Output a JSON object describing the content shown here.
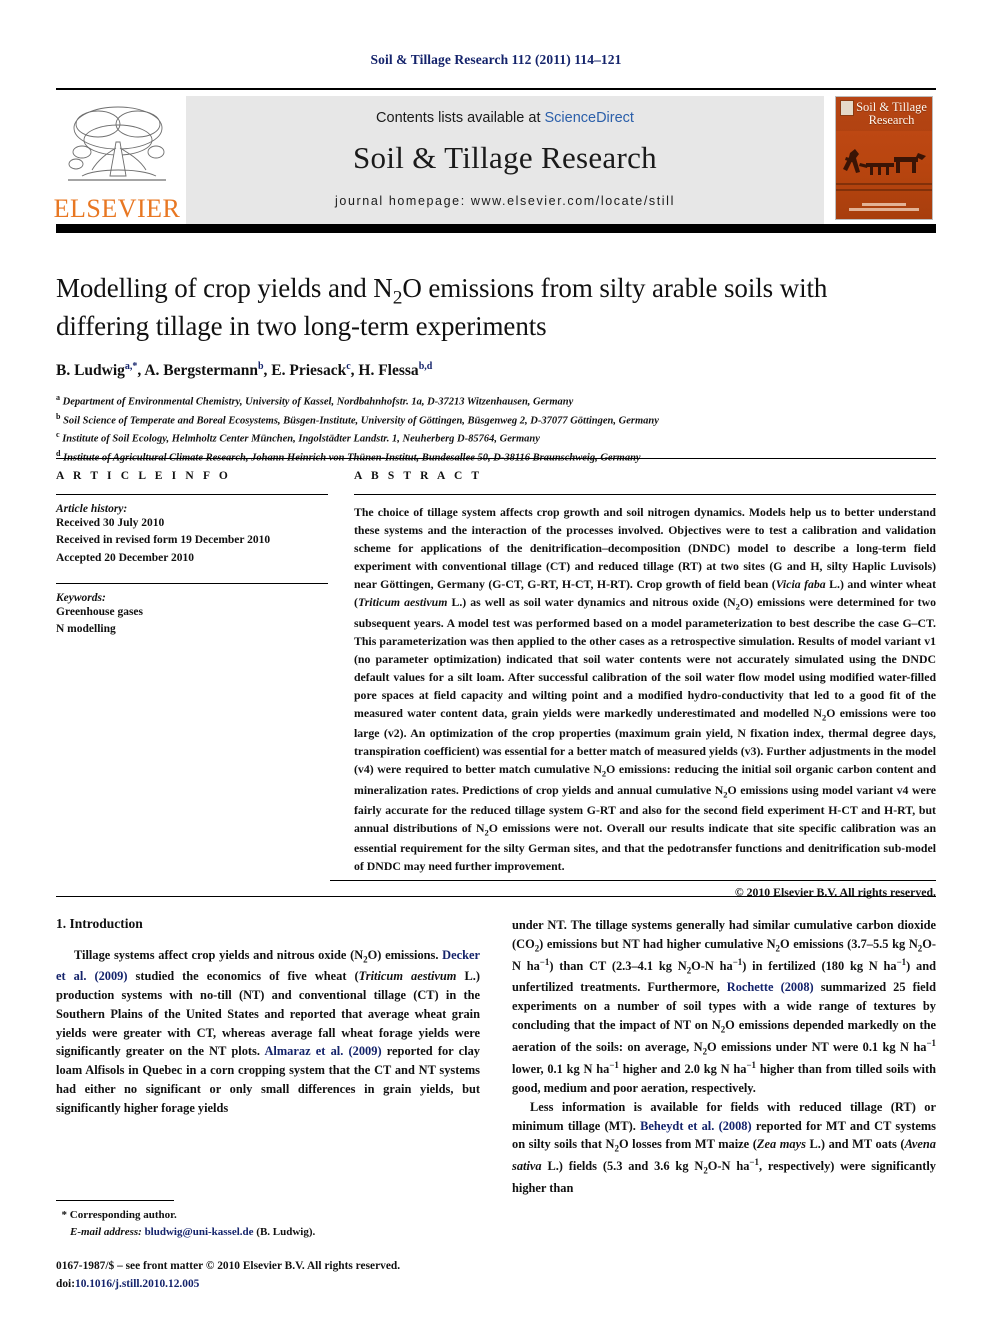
{
  "running_head": "Soil & Tillage Research 112 (2011) 114–121",
  "masthead": {
    "contents_prefix": "Contents lists available at ",
    "sciencedirect": "ScienceDirect",
    "journal_title": "Soil & Tillage Research",
    "homepage": "journal homepage: www.elsevier.com/locate/still",
    "publisher": "ELSEVIER",
    "cover_title": "Soil & Tillage Research",
    "colors": {
      "running_head": "#14236b",
      "link": "#2b5faa",
      "elsevier_orange": "#e87722",
      "cover_orange": "#b8450f",
      "masthead_gray": "#e7e7e7"
    }
  },
  "article": {
    "title_line1": "Modelling of crop yields and N2O emissions from silty arable soils with",
    "title_line2": "differing tillage in two long-term experiments",
    "authors_plain": "B. Ludwig a,*, A. Bergstermann b, E. Priesack c, H. Flessa b,d",
    "authors": [
      {
        "name": "B. Ludwig",
        "marks": "a,*"
      },
      {
        "name": "A. Bergstermann",
        "marks": "b"
      },
      {
        "name": "E. Priesack",
        "marks": "c"
      },
      {
        "name": "H. Flessa",
        "marks": "b,d"
      }
    ],
    "affiliations": [
      {
        "mark": "a",
        "text": "Department of Environmental Chemistry, University of Kassel, Nordbahnhofstr. 1a, D-37213 Witzenhausen, Germany"
      },
      {
        "mark": "b",
        "text": "Soil Science of Temperate and Boreal Ecosystems, Büsgen-Institute, University of Göttingen, Büsgenweg 2, D-37077 Göttingen, Germany"
      },
      {
        "mark": "c",
        "text": "Institute of Soil Ecology, Helmholtz Center München, Ingolstädter Landstr. 1, Neuherberg D-85764, Germany"
      },
      {
        "mark": "d",
        "text": "Institute of Agricultural Climate Research, Johann Heinrich von Thünen-Institut, Bundesallee 50, D-38116 Braunschweig, Germany"
      }
    ]
  },
  "article_info": {
    "heading": "A R T I C L E  I N F O",
    "history_label": "Article history:",
    "history": [
      "Received 30 July 2010",
      "Received in revised form 19 December 2010",
      "Accepted 20 December 2010"
    ],
    "keywords_label": "Keywords:",
    "keywords": [
      "Greenhouse gases",
      "N modelling"
    ]
  },
  "abstract": {
    "heading": "A B S T R A C T",
    "paragraph_1": "The choice of tillage system affects crop growth and soil nitrogen dynamics. Models help us to better understand these systems and the interaction of the processes involved. Objectives were to test a calibration and validation scheme for applications of the denitrification–decomposition (DNDC) model to describe a long-term field experiment with conventional tillage (CT) and reduced tillage (RT) at two sites (G and H, silty Haplic Luvisols) near Göttingen, Germany (G-CT, G-RT, H-CT, H-RT). Crop growth of field bean (",
    "italic_1": "Vicia faba",
    "paragraph_1b": " L.) and winter wheat (",
    "italic_2": "Triticum aestivum",
    "paragraph_1c": " L.) as well as soil water dynamics and nitrous oxide (N2O) emissions were determined for two subsequent years. A model test was performed based on a model parameterization to best describe the case G-CT. This parameterization was then applied to the other cases as a retrospective simulation. Results of model variant v1 (no parameter optimization) indicated that soil water contents were not accurately simulated using the DNDC default values for a silt loam. After successful calibration of the soil water flow model using modified water-filled pore spaces at field capacity and wilting point and a modified hydro-conductivity that led to a good fit of the measured water content data, grain yields were markedly underestimated and modelled N2O emissions were too large (v2). An optimization of the crop properties (maximum grain yield, N fixation index, thermal degree days, transpiration coefficient) was essential for a better match of measured yields (v3). Further adjustments in the model (v4) were required to better match cumulative N2O emissions: reducing the initial soil organic carbon content and mineralization rates. Predictions of crop yields and annual cumulative N2O emissions using model variant v4 were fairly accurate for the reduced tillage system G-RT and also for the second field experiment H-CT and H-RT, but annual distributions of N2O emissions were not. Overall our results indicate that site specific calibration was an essential requirement for the silty German sites, and that the pedotransfer functions and denitrification sub-model of DNDC may need further improvement.",
    "copyright": "© 2010 Elsevier B.V. All rights reserved."
  },
  "introduction": {
    "heading": "1. Introduction",
    "left_paragraph": "Tillage systems affect crop yields and nitrous oxide (N2O) emissions. Decker et al. (2009) studied the economics of five wheat (Triticum aestivum L.) production systems with no-till (NT) and conventional tillage (CT) in the Southern Plains of the United States and reported that average wheat grain yields were greater with CT, whereas average fall wheat forage yields were significantly greater on the NT plots. Almaraz et al. (2009) reported for clay loam Alfisols in Quebec in a corn cropping system that the CT and NT systems had either no significant or only small differences in grain yields, but significantly higher forage yields",
    "right_paragraph_1": "under NT. The tillage systems generally had similar cumulative carbon dioxide (CO2) emissions but NT had higher cumulative N2O emissions (3.7–5.5 kg N2O-N ha−1) than CT (2.3–4.1 kg N2O-N ha−1) in fertilized (180 kg N ha−1) and unfertilized treatments. Furthermore, Rochette (2008) summarized 25 field experiments on a number of soil types with a wide range of textures by concluding that the impact of NT on N2O emissions depended markedly on the aeration of the soils: on average, N2O emissions under NT were 0.1 kg N ha−1 lower, 0.1 kg N ha−1 higher and 2.0 kg N ha−1 higher than from tilled soils with good, medium and poor aeration, respectively.",
    "right_paragraph_2": "Less information is available for fields with reduced tillage (RT) or minimum tillage (MT). Beheydt et al. (2008) reported for MT and CT systems on silty soils that N2O losses from MT maize (Zea mays L.) and MT oats (Avena sativa L.) fields (5.3 and 3.6 kg N2O-N ha−1, respectively) were significantly higher than",
    "citations": [
      "Decker et al. (2009)",
      "Almaraz et al. (2009)",
      "Rochette (2008)",
      "Beheydt et al. (2008)"
    ]
  },
  "footnote": {
    "star": "*",
    "corresponding": "Corresponding author.",
    "email_label": "E-mail address:",
    "email": "bludwig@uni-kassel.de",
    "email_owner": "(B. Ludwig)."
  },
  "imprint": {
    "issn_line": "0167-1987/$ – see front matter © 2010 Elsevier B.V. All rights reserved.",
    "doi_label": "doi:",
    "doi": "10.1016/j.still.2010.12.005"
  }
}
